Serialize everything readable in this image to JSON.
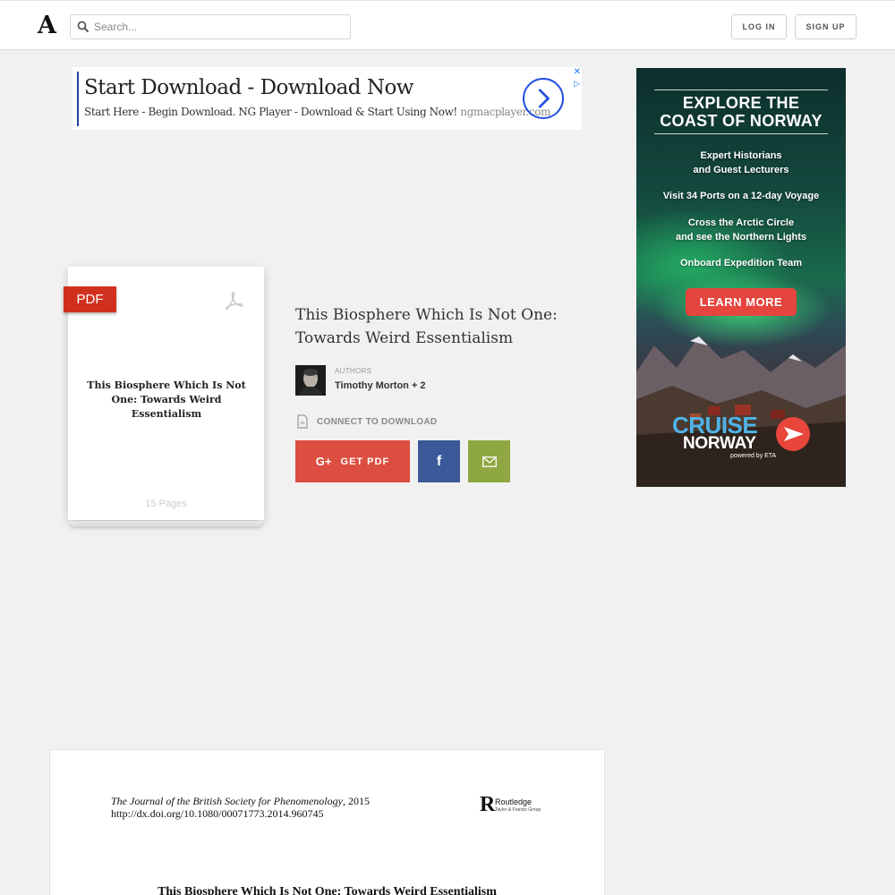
{
  "header": {
    "logo": "A",
    "search_placeholder": "Search...",
    "login_label": "LOG IN",
    "signup_label": "SIGN UP"
  },
  "ad_banner": {
    "headline": "Start Download - Download Now",
    "subline": "Start Here - Begin Download. NG Player - Download & Start Using Now!",
    "url": "ngmacplayer.com",
    "close": "✕",
    "adchoices": "▷"
  },
  "document": {
    "badge": "PDF",
    "cover_title": "This Biosphere Which Is Not One: Towards Weird Essentialism",
    "pages": "15 Pages",
    "title": "This Biosphere Which Is Not One: Towards Weird Essentialism",
    "authors_label": "AUTHORS",
    "authors": "Timothy Morton + 2",
    "connect_label": "CONNECT TO DOWNLOAD",
    "getpdf_icon": "G+",
    "getpdf_label": "GET PDF",
    "facebook_icon": "f"
  },
  "side_ad": {
    "title_line1": "EXPLORE THE",
    "title_line2": "COAST OF NORWAY",
    "line1a": "Expert Historians",
    "line1b": "and Guest Lecturers",
    "line2": "Visit 34 Ports on a 12-day Voyage",
    "line3a": "Cross the Arctic Circle",
    "line3b": "and see the Northern Lights",
    "line4": "Onboard Expedition Team",
    "cta": "LEARN MORE",
    "brand1": "CRUISE",
    "brand2": "NORWAY",
    "powered": "powered by ETA"
  },
  "preview": {
    "journal": "The Journal of the British Society for Phenomenology",
    "year": ", 2015",
    "doi": "http://dx.doi.org/10.1080/00071773.2014.960745",
    "publisher": "Routledge",
    "publisher_sub": "Taylor & Francis Group",
    "publisher_mark": "R",
    "title": "This Biosphere Which Is Not One: Towards Weird Essentialism"
  }
}
